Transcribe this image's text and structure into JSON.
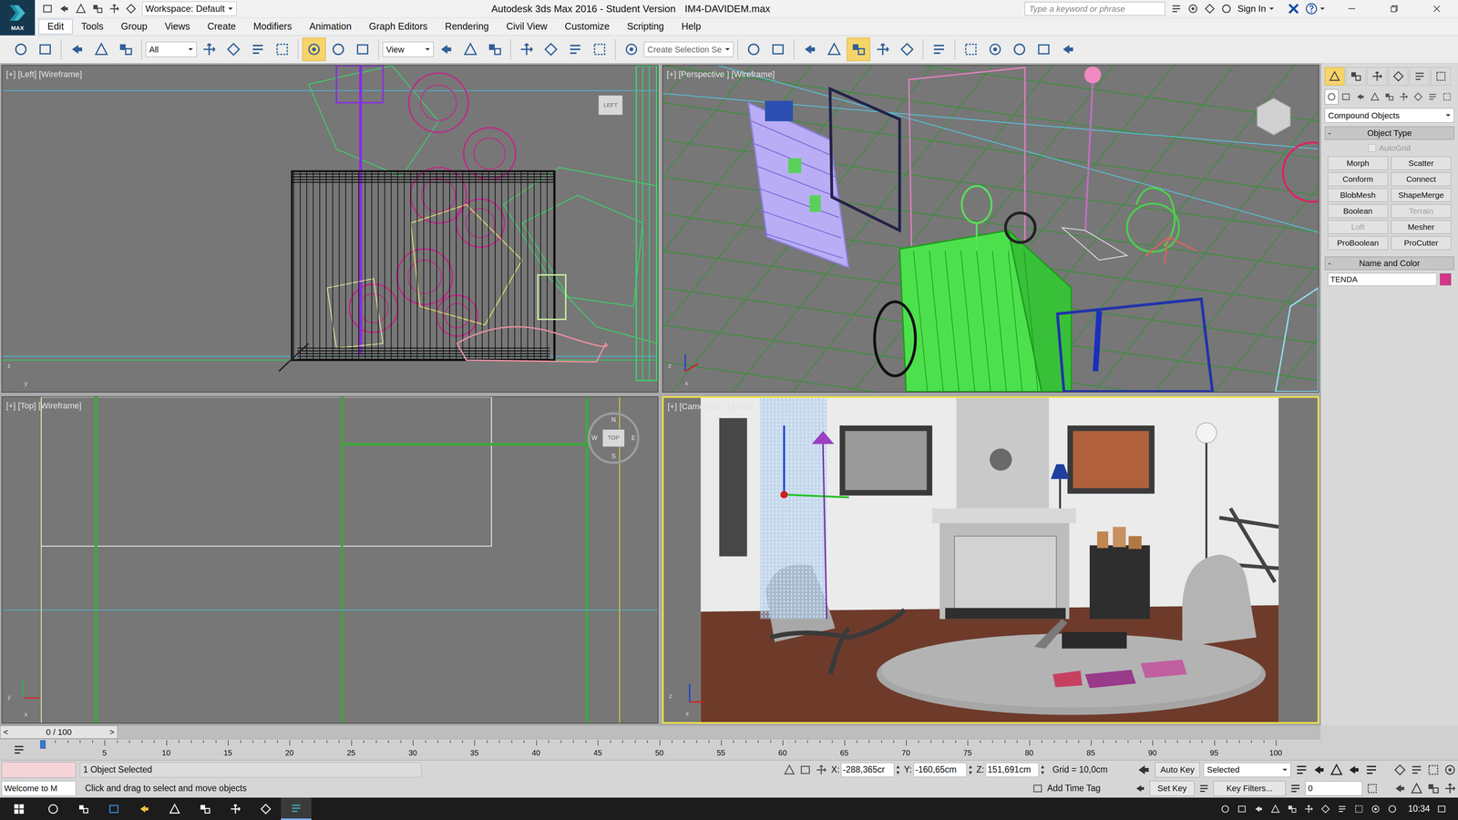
{
  "window": {
    "logo": "MAX",
    "workspace": "Workspace: Default",
    "title": "Autodesk 3ds Max 2016 - Student Version",
    "file": "IM4-DAVIDEM.max",
    "search_placeholder": "Type a keyword or phrase",
    "sign_in": "Sign In"
  },
  "menus": [
    {
      "label": "Edit",
      "selected": true
    },
    {
      "label": "Tools",
      "selected": false
    },
    {
      "label": "Group",
      "selected": false
    },
    {
      "label": "Views",
      "selected": false
    },
    {
      "label": "Create",
      "selected": false
    },
    {
      "label": "Modifiers",
      "selected": false
    },
    {
      "label": "Animation",
      "selected": false
    },
    {
      "label": "Graph Editors",
      "selected": false
    },
    {
      "label": "Rendering",
      "selected": false
    },
    {
      "label": "Civil View",
      "selected": false
    },
    {
      "label": "Customize",
      "selected": false
    },
    {
      "label": "Scripting",
      "selected": false
    },
    {
      "label": "Help",
      "selected": false
    }
  ],
  "toolbar": [
    {
      "kind": "icon",
      "selected": false
    },
    {
      "kind": "icon",
      "selected": false
    },
    {
      "kind": "separator"
    },
    {
      "kind": "icon",
      "selected": false
    },
    {
      "kind": "icon",
      "selected": false
    },
    {
      "kind": "icon",
      "selected": false
    },
    {
      "kind": "separator"
    },
    {
      "kind": "dropdown",
      "value": "All"
    },
    {
      "kind": "icon",
      "selected": false
    },
    {
      "kind": "icon",
      "selected": false
    },
    {
      "kind": "icon",
      "selected": false
    },
    {
      "kind": "icon",
      "selected": false
    },
    {
      "kind": "separator"
    },
    {
      "kind": "icon",
      "selected": true
    },
    {
      "kind": "icon",
      "selected": false
    },
    {
      "kind": "icon",
      "selected": false
    },
    {
      "kind": "separator"
    },
    {
      "kind": "dropdown",
      "value": "View"
    },
    {
      "kind": "icon",
      "selected": false
    },
    {
      "kind": "icon",
      "selected": false
    },
    {
      "kind": "icon",
      "selected": false
    },
    {
      "kind": "separator"
    },
    {
      "kind": "icon",
      "selected": false
    },
    {
      "kind": "icon",
      "selected": false
    },
    {
      "kind": "icon",
      "selected": false
    },
    {
      "kind": "icon",
      "selected": false
    },
    {
      "kind": "separator"
    },
    {
      "kind": "icon",
      "selected": false
    },
    {
      "kind": "field",
      "value": "Create Selection Se"
    },
    {
      "kind": "separator"
    },
    {
      "kind": "icon",
      "selected": false
    },
    {
      "kind": "icon",
      "selected": false
    },
    {
      "kind": "separator"
    },
    {
      "kind": "icon",
      "selected": false
    },
    {
      "kind": "icon",
      "selected": false
    },
    {
      "kind": "icon",
      "selected": true
    },
    {
      "kind": "icon",
      "selected": false
    },
    {
      "kind": "icon",
      "selected": false
    },
    {
      "kind": "separator"
    },
    {
      "kind": "icon",
      "selected": false
    },
    {
      "kind": "separator"
    },
    {
      "kind": "icon",
      "selected": false
    },
    {
      "kind": "icon",
      "selected": false
    },
    {
      "kind": "icon",
      "selected": false
    },
    {
      "kind": "icon",
      "selected": false
    },
    {
      "kind": "icon",
      "selected": false
    }
  ],
  "viewports": [
    {
      "kind": "left",
      "label": "[+] [Left] [Wireframe]",
      "active": false,
      "cube": "LEFT",
      "axes": [
        "z",
        "y"
      ]
    },
    {
      "kind": "perspective",
      "label": "[+] [Perspective ] [Wireframe]",
      "active": false,
      "axes": [
        "z",
        "x"
      ]
    },
    {
      "kind": "top",
      "label": "[+] [Top] [Wireframe]",
      "active": false,
      "cube": "TOP",
      "compass": [
        "N",
        "S",
        "W",
        "E"
      ],
      "axes": [
        "y",
        "x"
      ]
    },
    {
      "kind": "camera",
      "label": "[+] [Camera001 ] [Shad",
      "active": true,
      "axes": [
        "z",
        "x"
      ]
    }
  ],
  "command_panel": {
    "tabs": [
      {
        "selected": true
      },
      {
        "selected": false
      },
      {
        "selected": false
      },
      {
        "selected": false
      },
      {
        "selected": false
      },
      {
        "selected": false
      }
    ],
    "categories": [
      {
        "selected": true
      },
      {
        "selected": false
      },
      {
        "selected": false
      },
      {
        "selected": false
      },
      {
        "selected": false
      },
      {
        "selected": false
      },
      {
        "selected": false
      },
      {
        "selected": false
      },
      {
        "selected": false
      }
    ],
    "dropdown": "Compound Objects",
    "object_type": {
      "title": "Object Type",
      "collapse": "-",
      "autogrid": {
        "label": "AutoGrid",
        "checked": false,
        "disabled": true
      },
      "buttons": [
        {
          "label": "Morph",
          "disabled": false
        },
        {
          "label": "Scatter",
          "disabled": false
        },
        {
          "label": "Conform",
          "disabled": false
        },
        {
          "label": "Connect",
          "disabled": false
        },
        {
          "label": "BlobMesh",
          "disabled": false
        },
        {
          "label": "ShapeMerge",
          "disabled": false
        },
        {
          "label": "Boolean",
          "disabled": false
        },
        {
          "label": "Terrain",
          "disabled": true
        },
        {
          "label": "Loft",
          "disabled": true
        },
        {
          "label": "Mesher",
          "disabled": false
        },
        {
          "label": "ProBoolean",
          "disabled": false
        },
        {
          "label": "ProCutter",
          "disabled": false
        }
      ]
    },
    "name_and_color": {
      "title": "Name and Color",
      "collapse": "-",
      "name": "TENDA",
      "color": "#d6338a"
    }
  },
  "timeline": {
    "counter": "0 / 100",
    "prev": "<",
    "next": ">",
    "level": 0,
    "ticks": [
      "5",
      "10",
      "15",
      "20",
      "25",
      "30",
      "35",
      "40",
      "45",
      "50",
      "55",
      "60",
      "65",
      "70",
      "75",
      "80",
      "85",
      "90",
      "95",
      "100"
    ]
  },
  "status": {
    "welcome": "Welcome to M",
    "selection": "1 Object Selected",
    "prompt": "Click and drag to select and move objects",
    "x_label": "X:",
    "x": "-288,365cr",
    "y_label": "Y:",
    "y": "-160,65cm",
    "z_label": "Z:",
    "z": "151,691cm",
    "grid": "Grid = 10,0cm",
    "add_time_tag": "Add Time Tag",
    "auto_key": "Auto Key",
    "key_mode": "Selected",
    "set_key": "Set Key",
    "key_filters": "Key Filters...",
    "frame": "0"
  },
  "taskbar": {
    "apps": [
      {
        "selected": false
      },
      {
        "selected": false
      },
      {
        "selected": false
      },
      {
        "selected": false
      },
      {
        "selected": false
      },
      {
        "selected": false
      },
      {
        "selected": true
      }
    ],
    "time": "10:34"
  }
}
